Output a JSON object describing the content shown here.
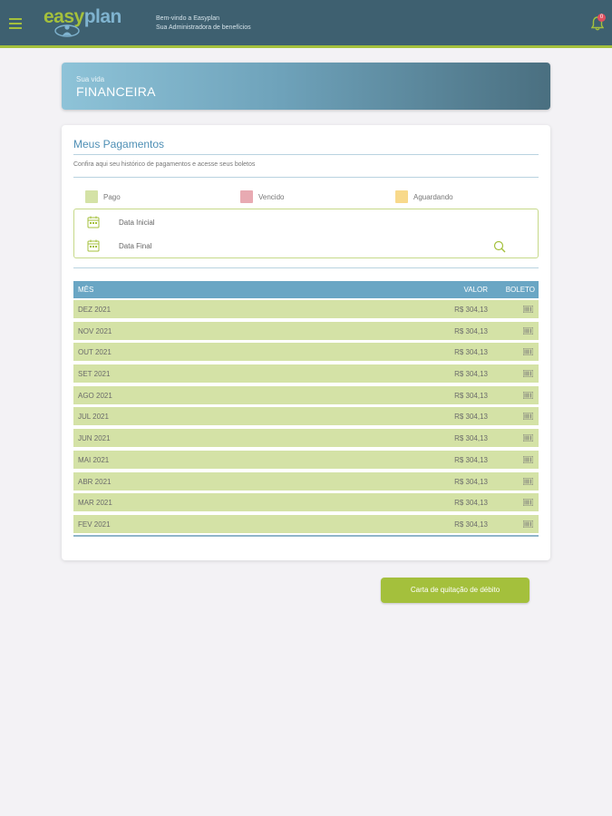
{
  "header": {
    "logo": {
      "easy": "easy",
      "plan": "plan"
    },
    "welcome_line1": "Bem-vindo a Easyplan",
    "welcome_line2": "Sua Administradora de benefícios",
    "notifications_count": "0",
    "brand_color": "#a4c03c",
    "header_color": "#3e6070"
  },
  "hero": {
    "subtitle": "Sua vida",
    "title": "FINANCEIRA"
  },
  "payments": {
    "title": "Meus Pagamentos",
    "description": "Confira aqui seu histórico de pagamentos e acesse seus boletos",
    "legend": [
      {
        "label": "Pago",
        "color": "#d4e2a6"
      },
      {
        "label": "Vencido",
        "color": "#e8aab2"
      },
      {
        "label": "Aguardando",
        "color": "#f8d98b"
      }
    ],
    "filters": {
      "start_date_label": "Data Inicial",
      "end_date_label": "Data Final"
    },
    "table": {
      "headers": {
        "month": "MÊS",
        "value": "VALOR",
        "boleto": "BOLETO"
      },
      "rows": [
        {
          "month": "DEZ 2021",
          "value": "R$ 304,13"
        },
        {
          "month": "NOV 2021",
          "value": "R$ 304,13"
        },
        {
          "month": "OUT 2021",
          "value": "R$ 304,13"
        },
        {
          "month": "SET 2021",
          "value": "R$ 304,13"
        },
        {
          "month": "AGO 2021",
          "value": "R$ 304,13"
        },
        {
          "month": "JUL 2021",
          "value": "R$ 304,13"
        },
        {
          "month": "JUN 2021",
          "value": "R$ 304,13"
        },
        {
          "month": "MAI 2021",
          "value": "R$ 304,13"
        },
        {
          "month": "ABR 2021",
          "value": "R$ 304,13"
        },
        {
          "month": "MAR 2021",
          "value": "R$ 304,13"
        },
        {
          "month": "FEV 2021",
          "value": "R$ 304,13"
        }
      ]
    }
  },
  "actions": {
    "debit_letter": "Carta de quitação de débito"
  }
}
